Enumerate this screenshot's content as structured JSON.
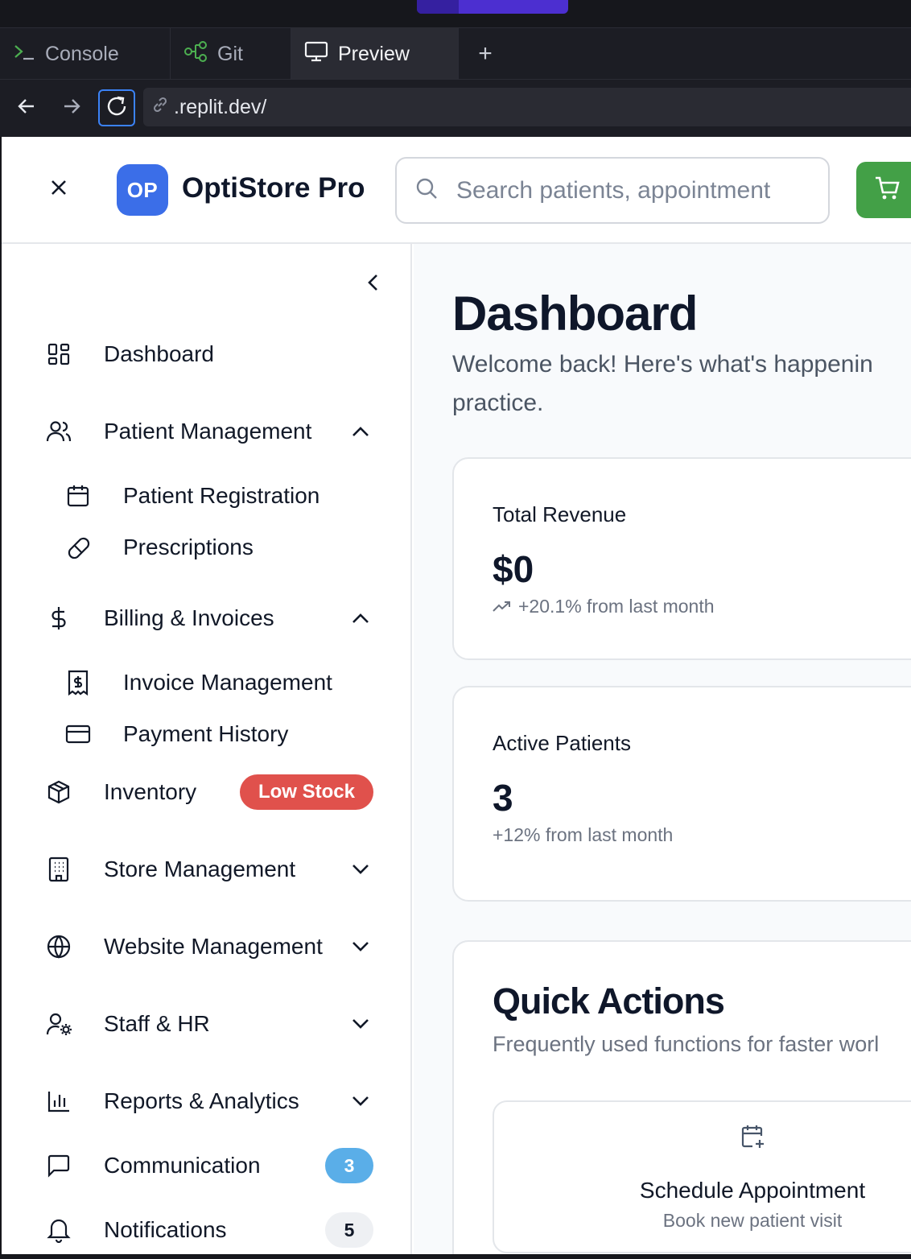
{
  "ide": {
    "tabs": [
      {
        "label": "Console",
        "icon": "terminal-icon"
      },
      {
        "label": "Git",
        "icon": "git-branch-icon"
      },
      {
        "label": "Preview",
        "icon": "monitor-icon"
      }
    ],
    "add_tab": "+",
    "url": ".replit.dev/"
  },
  "header": {
    "logo_initials": "OP",
    "brand": "OptiStore Pro",
    "search_placeholder": "Search patients, appointment"
  },
  "sidebar": {
    "items": [
      {
        "label": "Dashboard",
        "icon": "layout-grid-icon"
      },
      {
        "label": "Patient Management",
        "icon": "users-icon",
        "expanded": true
      },
      {
        "label": "Patient Registration",
        "icon": "calendar-icon",
        "sub": true
      },
      {
        "label": "Prescriptions",
        "icon": "pill-icon",
        "sub": true
      },
      {
        "label": "Billing & Invoices",
        "icon": "dollar-icon",
        "expanded": true
      },
      {
        "label": "Invoice Management",
        "icon": "receipt-icon",
        "sub": true
      },
      {
        "label": "Payment History",
        "icon": "credit-card-icon",
        "sub": true
      },
      {
        "label": "Inventory",
        "icon": "package-icon",
        "badge": "Low Stock"
      },
      {
        "label": "Store Management",
        "icon": "building-icon",
        "expanded": false
      },
      {
        "label": "Website Management",
        "icon": "globe-icon",
        "expanded": false
      },
      {
        "label": "Staff & HR",
        "icon": "user-cog-icon",
        "expanded": false
      },
      {
        "label": "Reports & Analytics",
        "icon": "bar-chart-icon",
        "expanded": false
      },
      {
        "label": "Communication",
        "icon": "message-square-icon",
        "count": "3"
      },
      {
        "label": "Notifications",
        "icon": "bell-icon",
        "count": "5"
      }
    ]
  },
  "main": {
    "title": "Dashboard",
    "subtitle": "Welcome back! Here's what's happening practice.",
    "subtitle_line1": "Welcome back! Here's what's happenin",
    "subtitle_line2": "practice.",
    "stats": [
      {
        "label": "Total Revenue",
        "value": "$0",
        "trend": "+20.1% from last month"
      },
      {
        "label": "Active Patients",
        "value": "3",
        "trend": "+12% from last month"
      }
    ],
    "quick_actions": {
      "title": "Quick Actions",
      "subtitle": "Frequently used functions for faster worl",
      "items": [
        {
          "title": "Schedule Appointment",
          "subtitle": "Book new patient visit",
          "icon": "calendar-plus-icon"
        }
      ]
    }
  },
  "colors": {
    "primary": "#3b6ee8",
    "cart": "#43a047",
    "low_stock": "#e0514c",
    "count_badge": "#5aaee8"
  }
}
